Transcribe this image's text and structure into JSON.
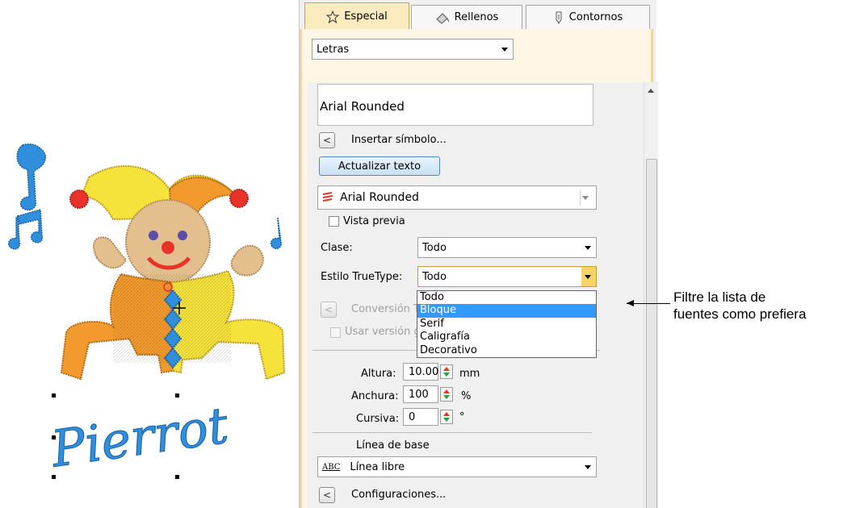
{
  "tabs": [
    {
      "label": "Especial",
      "icon": "star-icon",
      "active": true
    },
    {
      "label": "Rellenos",
      "icon": "fill-icon",
      "active": false
    },
    {
      "label": "Contornos",
      "icon": "outline-icon",
      "active": false
    }
  ],
  "object_type": {
    "value": "Letras"
  },
  "text_box": {
    "value": "Arial Rounded"
  },
  "insert_symbol": {
    "button": "<",
    "label": "Insertar símbolo..."
  },
  "update_button": "Actualizar texto",
  "font_combo": {
    "value": "Arial Rounded",
    "icon": "embroidery-font-icon"
  },
  "preview_checkbox": {
    "label": "Vista previa",
    "checked": false
  },
  "clase": {
    "label": "Clase:",
    "value": "Todo"
  },
  "estilo": {
    "label": "Estilo TrueType:",
    "value": "Todo",
    "options": [
      "Todo",
      "Bloque",
      "Serif",
      "Caligrafía",
      "Decorativo"
    ],
    "highlighted": "Bloque"
  },
  "conversion": {
    "button": "<",
    "label": "Conversión T"
  },
  "use_version": {
    "label": "Usar versión g",
    "checked": false
  },
  "altura": {
    "label": "Altura:",
    "value": "10.00",
    "unit": "mm"
  },
  "anchura": {
    "label": "Anchura:",
    "value": "100",
    "unit": "%"
  },
  "cursiva": {
    "label": "Cursiva:",
    "value": "0",
    "unit": "°"
  },
  "baseline": {
    "heading": "Línea de base",
    "value": "Línea libre",
    "icon_text": "ABC"
  },
  "settings": {
    "button": "<",
    "label": "Configuraciones..."
  },
  "canvas_text": "Pierrot",
  "callout": {
    "line1": "Filtre la lista de",
    "line2": "fuentes como prefiera"
  },
  "colors": {
    "accent": "#f7d26a",
    "selection": "#3399ff",
    "tab_active": "#fdebc0",
    "panel_bg": "#fff6e6",
    "embroidery_blue": "#2f8fdc",
    "embroidery_orange": "#f29a2e",
    "embroidery_yellow": "#f5e23a"
  }
}
